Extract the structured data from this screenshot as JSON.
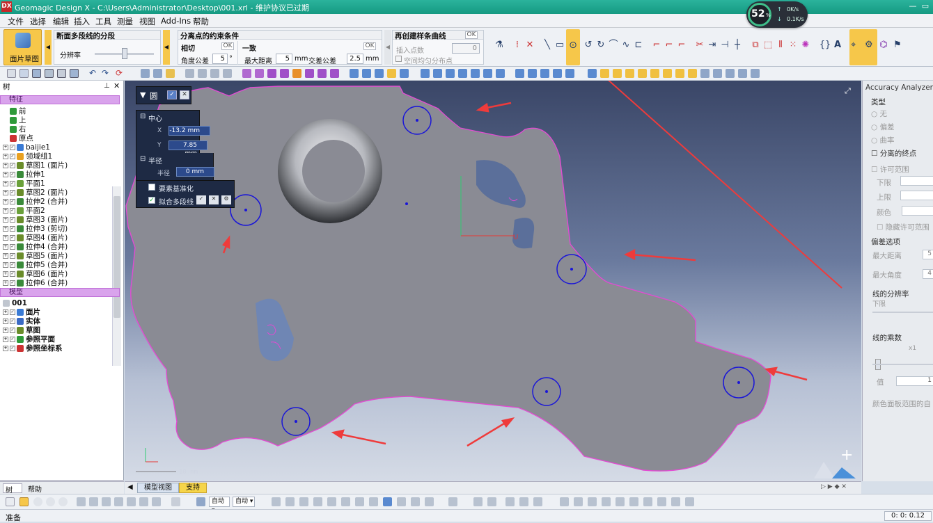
{
  "app": {
    "logo": "DX",
    "title": "Geomagic Design X - C:\\Users\\Administrator\\Desktop\\001.xrl - 维护协议已过期",
    "perf_percent": "52",
    "perf_unit": "%",
    "net_up": "0K/s",
    "net_down": "0.1K/s"
  },
  "menu": [
    "文件",
    "选择",
    "编辑",
    "插入",
    "工具",
    "测量",
    "视图",
    "Add-Ins",
    "帮助"
  ],
  "ribbon": {
    "mesh_sketch": "面片草图",
    "sec1": {
      "title": "断面多段线的分段",
      "label": "分辨率"
    },
    "sec2": {
      "title": "分离点的约束条件",
      "tangent": "相切",
      "ok1": "OK",
      "angle_label": "角度公差",
      "angle_value": "5",
      "angle_unit": "°",
      "consistent": "一致",
      "ok2": "OK",
      "maxdist_label": "最大距离",
      "maxdist_value": "5",
      "maxdist_unit": "mm",
      "cross_label": "交差公差",
      "cross_value": "2.5",
      "cross_unit": "mm"
    },
    "sec3": {
      "title": "再创建样条曲线",
      "ok": "OK",
      "insert_label": "插入点数",
      "insert_value": "0",
      "spatial": "空间均匀分布点"
    }
  },
  "left": {
    "tree_title": "树",
    "features_section": "特征",
    "features": [
      "前",
      "上",
      "右",
      "原点",
      "baijie1",
      "领域组1",
      "草图1 (面片)",
      "拉伸1",
      "平面1",
      "草图2 (面片)",
      "拉伸2 (合并)",
      "平面2",
      "草图3 (面片)",
      "拉伸3 (剪切)",
      "草图4 (面片)",
      "拉伸4 (合并)",
      "草图5 (面片)",
      "拉伸5 (合并)",
      "草图6 (面片)",
      "拉伸6 (合并)"
    ],
    "model_section": "模型",
    "model_root": "001",
    "model_items": [
      "面片",
      "实体",
      "草图",
      "参照平面",
      "参照坐标系"
    ],
    "tab_tree": "树",
    "tab_help": "帮助"
  },
  "circle_panel": {
    "title": "圆",
    "center": "中心",
    "x_label": "X",
    "x_value": "-13.2 mm",
    "y_label": "Y",
    "y_value": "7.85 mm",
    "radius": "半径",
    "radius_label": "半径",
    "radius_value": "0 mm",
    "normalize": "要素基准化",
    "fit_polyline": "拟合多段线"
  },
  "viewport": {
    "scale": "10 mm",
    "axis_u": "U",
    "axis_v": "V"
  },
  "right": {
    "title": "Accuracy Analyzer(TM)",
    "type": "类型",
    "opt_none": "无",
    "opt_dev": "偏差",
    "opt_curv": "曲率",
    "sep_end": "分离的终点",
    "allow_range": "许可范围",
    "lower": "下限",
    "upper": "上限",
    "color": "颜色",
    "hide_range": "隐藏许可范围",
    "dev_opts": "偏差选项",
    "max_dist": "最大距离",
    "max_dist_val": "5",
    "max_angle": "最大角度",
    "max_angle_val": "4",
    "line_res": "线的分辨率",
    "res_lower": "下限",
    "line_mult": "线的乘数",
    "mult_x": "x1",
    "value": "值",
    "value_v": "1",
    "color_range": "颜色面板范围的自"
  },
  "bottom": {
    "tab_model": "模型视图",
    "tab_support": "支持",
    "dd1": "自动",
    "dd2": "自动"
  },
  "status": {
    "ready": "准备",
    "time": "0: 0: 0.12"
  }
}
